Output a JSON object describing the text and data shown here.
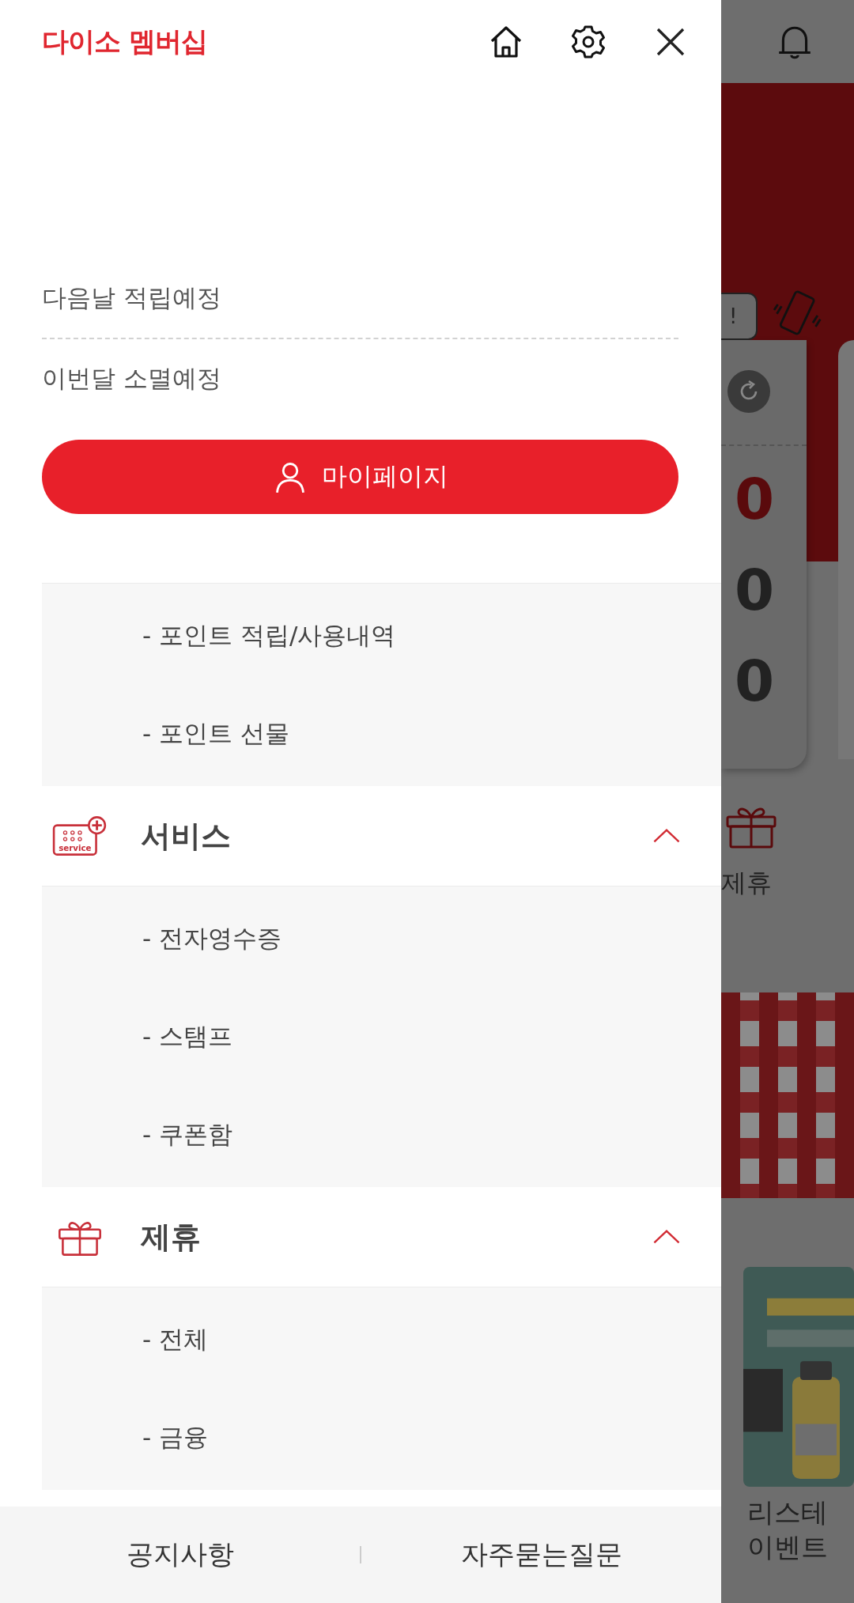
{
  "header": {
    "logo": "다이소 멤버십"
  },
  "points": [
    {
      "label": "다음날 적립예정"
    },
    {
      "label": "이번달 소멸예정"
    }
  ],
  "mypage_button": {
    "label": "마이페이지"
  },
  "menu": [
    {
      "children": [
        {
          "label": "- 포인트 적립/사용내역"
        },
        {
          "label": "- 포인트 선물"
        }
      ]
    },
    {
      "kind": "service",
      "title": "서비스",
      "icon_text": "service",
      "expanded": true,
      "children": [
        {
          "label": "- 전자영수증"
        },
        {
          "label": "- 스탬프"
        },
        {
          "label": "- 쿠폰함"
        }
      ]
    },
    {
      "kind": "gift",
      "title": "제휴",
      "expanded": true,
      "children": [
        {
          "label": "- 전체"
        },
        {
          "label": "- 금융"
        }
      ]
    }
  ],
  "footer": {
    "links": [
      "공지사항",
      "자주묻는질문"
    ]
  },
  "background_app": {
    "bubble_text": "!",
    "balances": [
      {
        "value": "0",
        "highlight": true
      },
      {
        "value": "0",
        "highlight": false
      },
      {
        "value": "0",
        "highlight": false
      }
    ],
    "shortcut_label": "제휴",
    "event_lines": [
      "리스테",
      "이벤트"
    ]
  }
}
